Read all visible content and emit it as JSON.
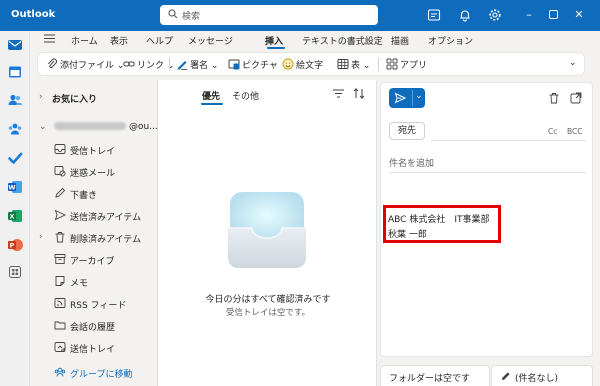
{
  "app": {
    "title": "Outlook"
  },
  "search": {
    "placeholder": "検索"
  },
  "ribbon": {
    "tabs": [
      "ホーム",
      "表示",
      "ヘルプ",
      "メッセージ",
      "挿入",
      "テキストの書式設定",
      "描画",
      "オプション"
    ],
    "active_tab": "挿入",
    "tools": {
      "attach": "添付ファイル",
      "link": "リンク",
      "signature": "署名",
      "picture": "ピクチャ",
      "emoji": "絵文字",
      "table": "表",
      "apps": "アプリ"
    }
  },
  "folders": {
    "favorites": "お気に入り",
    "account_suffix": "@ou...",
    "items": [
      {
        "label": "受信トレイ",
        "icon": "inbox-icon"
      },
      {
        "label": "迷惑メール",
        "icon": "junk-icon"
      },
      {
        "label": "下書き",
        "icon": "pencil-icon"
      },
      {
        "label": "送信済みアイテム",
        "icon": "send-icon"
      },
      {
        "label": "削除済みアイテム",
        "icon": "trash-icon"
      },
      {
        "label": "アーカイブ",
        "icon": "archive-icon"
      },
      {
        "label": "メモ",
        "icon": "note-icon"
      },
      {
        "label": "RSS フィード",
        "icon": "rss-icon"
      },
      {
        "label": "会話の履歴",
        "icon": "folder-icon"
      },
      {
        "label": "送信トレイ",
        "icon": "outbox-icon"
      }
    ],
    "groups_link": "グループに移動"
  },
  "message_list": {
    "tab_focused": "優先",
    "tab_other": "その他",
    "empty_title": "今日の分はすべて確認済みです",
    "empty_subtitle": "受信トレイは空です。"
  },
  "compose": {
    "to_label": "宛先",
    "cc": "Cc",
    "bcc": "BCC",
    "subject_placeholder": "件名を追加",
    "signature_line1": "ABC 株式会社　IT事業部",
    "signature_line2": "秋葉 一郎"
  },
  "drafts": {
    "folder_empty": "フォルダーは空です",
    "untitled": "(件名なし)"
  },
  "colors": {
    "accent": "#0f6cbd",
    "highlight": "#e00000"
  }
}
